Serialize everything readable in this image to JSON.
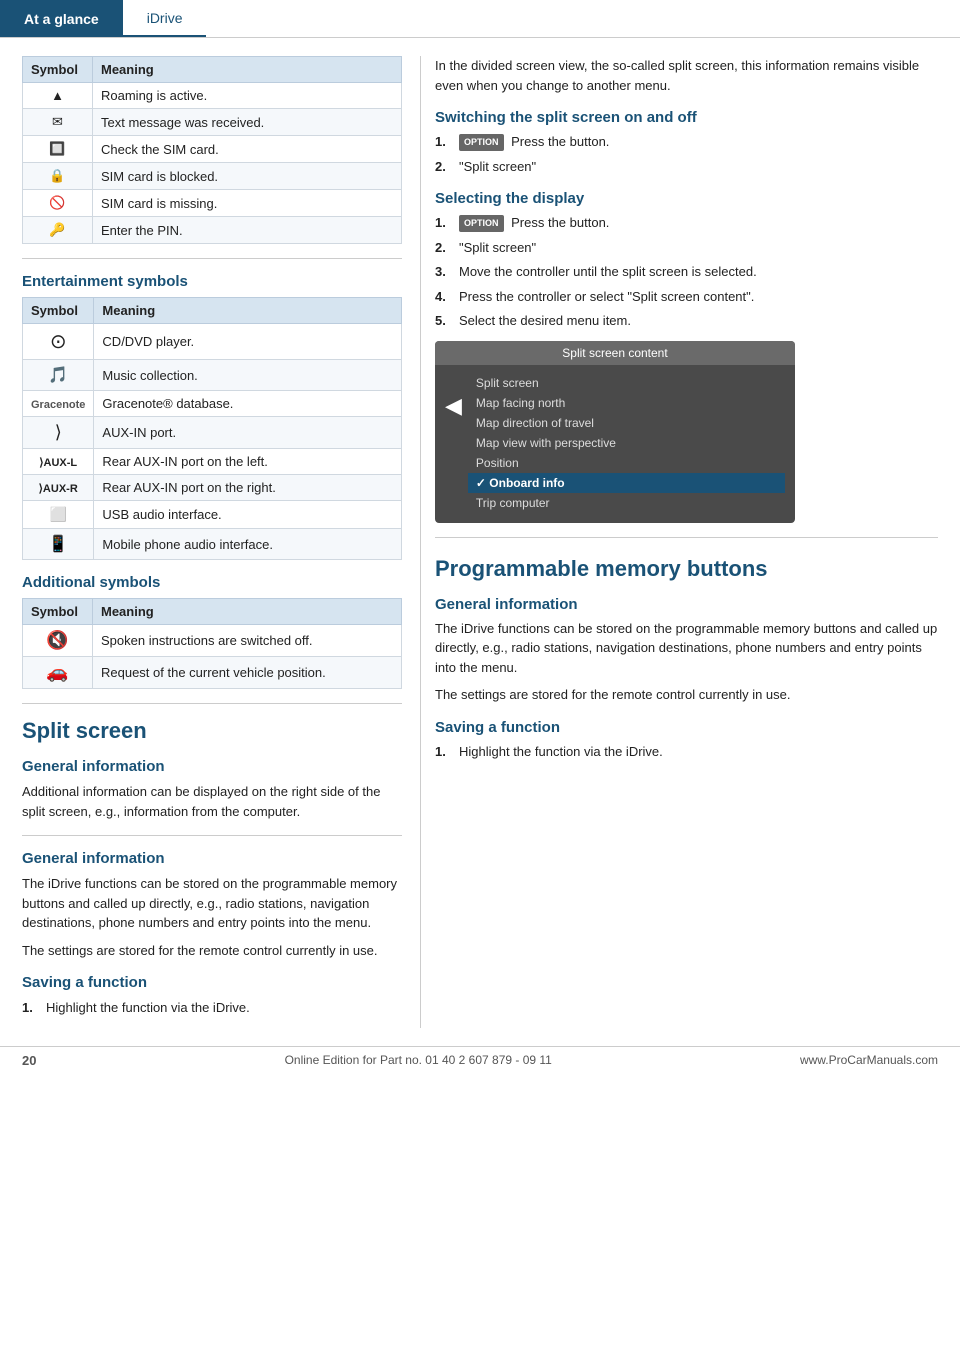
{
  "header": {
    "tab1": "At a glance",
    "tab2": "iDrive"
  },
  "left": {
    "phone_table": {
      "col1": "Symbol",
      "col2": "Meaning",
      "rows": [
        {
          "symbol": "▲",
          "meaning": "Roaming is active."
        },
        {
          "symbol": "✉",
          "meaning": "Text message was received."
        },
        {
          "symbol": "🔲",
          "meaning": "Check the SIM card."
        },
        {
          "symbol": "🔒",
          "meaning": "SIM card is blocked."
        },
        {
          "symbol": "🚫",
          "meaning": "SIM card is missing."
        },
        {
          "symbol": "🔑",
          "meaning": "Enter the PIN."
        }
      ]
    },
    "entertainment_heading": "Entertainment symbols",
    "entertainment_table": {
      "col1": "Symbol",
      "col2": "Meaning",
      "rows": [
        {
          "symbol": "⊙",
          "meaning": "CD/DVD player."
        },
        {
          "symbol": "🎵",
          "meaning": "Music collection."
        },
        {
          "symbol": "G",
          "meaning": "Gracenote® database."
        },
        {
          "symbol": "⟩",
          "meaning": "AUX-IN port."
        },
        {
          "symbol": "AUX-L",
          "meaning": "Rear AUX-IN port on the left."
        },
        {
          "symbol": "AUX-R",
          "meaning": "Rear AUX-IN port on the right."
        },
        {
          "symbol": "USB",
          "meaning": "USB audio interface."
        },
        {
          "symbol": "📱",
          "meaning": "Mobile phone audio interface."
        }
      ]
    },
    "additional_heading": "Additional symbols",
    "additional_table": {
      "col1": "Symbol",
      "col2": "Meaning",
      "rows": [
        {
          "symbol": "🔇",
          "meaning": "Spoken instructions are switched off."
        },
        {
          "symbol": "🚗",
          "meaning": "Request of the current vehicle position."
        }
      ]
    },
    "split_screen_heading": "Split screen",
    "split_screen_general_heading": "General information",
    "split_screen_general_text": "Additional information can be displayed on the right side of the split screen, e.g., information from the computer.",
    "general_info_heading2": "General information",
    "general_info_text2": "The iDrive functions can be stored on the programmable memory buttons and called up directly, e.g., radio stations, navigation destinations, phone numbers and entry points into the menu.\n\nThe settings are stored for the remote control currently in use.",
    "saving_function_heading": "Saving a function",
    "saving_function_step1": "Highlight the function via the iDrive."
  },
  "right": {
    "intro_text": "In the divided screen view, the so-called split screen, this information remains visible even when you change to another menu.",
    "switching_heading": "Switching the split screen on and off",
    "switching_steps": [
      {
        "num": "1.",
        "icon": "OPTION",
        "text": "Press the button."
      },
      {
        "num": "2.",
        "text": "\"Split screen\""
      }
    ],
    "selecting_heading": "Selecting the display",
    "selecting_steps": [
      {
        "num": "1.",
        "icon": "OPTION",
        "text": "Press the button."
      },
      {
        "num": "2.",
        "text": "\"Split screen\""
      },
      {
        "num": "3.",
        "text": "Move the controller until the split screen is selected."
      },
      {
        "num": "4.",
        "text": "Press the controller or select \"Split screen content\"."
      },
      {
        "num": "5.",
        "text": "Select the desired menu item."
      }
    ],
    "split_screen_content_title": "Split screen content",
    "split_screen_items": [
      {
        "text": "Split screen",
        "active": false,
        "checked": false
      },
      {
        "text": "Map facing north",
        "active": false,
        "checked": false
      },
      {
        "text": "Map direction of travel",
        "active": false,
        "checked": false
      },
      {
        "text": "Map view with perspective",
        "active": false,
        "checked": false
      },
      {
        "text": "Position",
        "active": false,
        "checked": false
      },
      {
        "text": "Onboard info",
        "active": true,
        "checked": true
      },
      {
        "text": "Trip computer",
        "active": false,
        "checked": false
      }
    ],
    "programmable_memory_heading": "Programmable memory buttons",
    "general_information_heading": "General information",
    "general_information_text": "The iDrive functions can be stored on the programmable memory buttons and called up directly, e.g., radio stations, navigation destinations, phone numbers and entry points into the menu.\n\nThe settings are stored for the remote control currently in use.",
    "saving_function_heading": "Saving a function",
    "saving_step1": "Highlight the function via the iDrive."
  },
  "footer": {
    "page_num": "20",
    "citation": "Online Edition for Part no. 01 40 2 607 879 - 09 11",
    "url": "www.ProCarManuals.com"
  }
}
